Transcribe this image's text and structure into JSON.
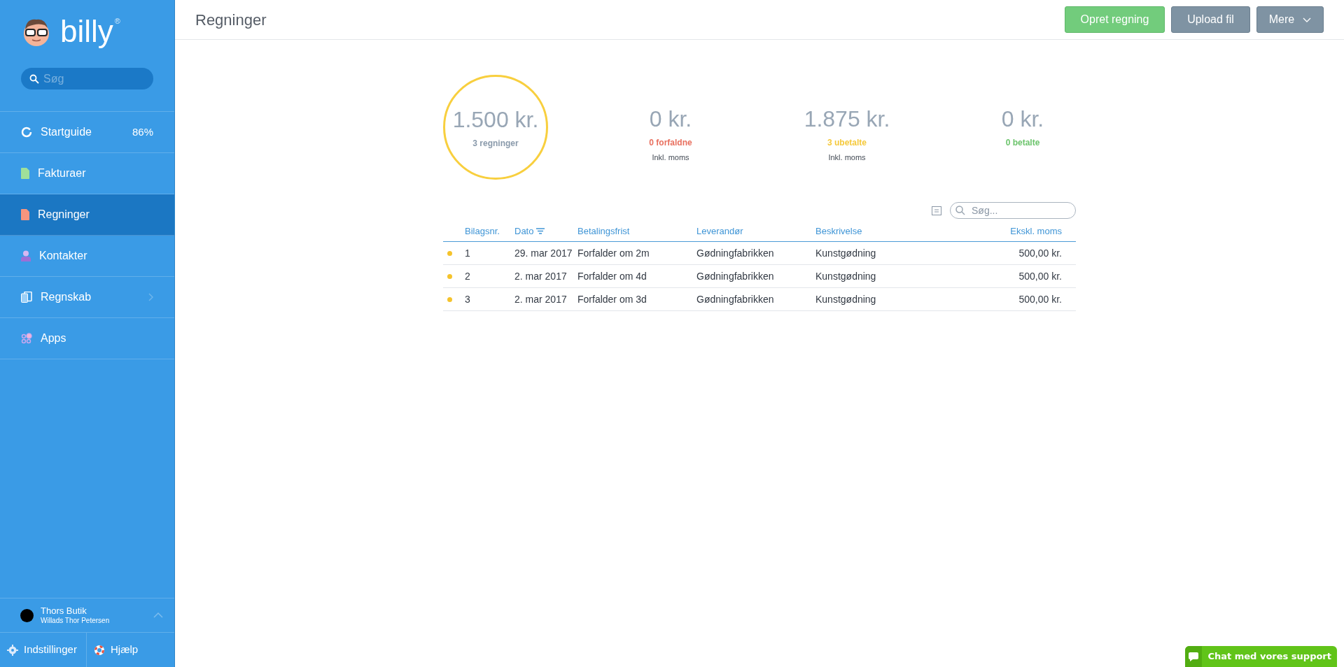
{
  "sidebar": {
    "logo": "billy",
    "logo_mark": "®",
    "search": {
      "placeholder": "Søg"
    },
    "items": [
      {
        "label": "Startguide",
        "badge": "86%",
        "selected": false,
        "submenu": false
      },
      {
        "label": "Fakturaer",
        "selected": false,
        "submenu": false
      },
      {
        "label": "Regninger",
        "selected": true,
        "submenu": false
      },
      {
        "label": "Kontakter",
        "selected": false,
        "submenu": false
      },
      {
        "label": "Regnskab",
        "selected": false,
        "submenu": true
      },
      {
        "label": "Apps",
        "selected": false,
        "submenu": false
      }
    ],
    "account": {
      "company": "Thors Butik",
      "user": "Willads Thor Petersen"
    },
    "footer": [
      "Indstillinger",
      "Hjælp"
    ]
  },
  "header": {
    "title": "Regninger",
    "buttons": [
      {
        "label": "Opret regning",
        "kind": "primary"
      },
      {
        "label": "Upload fil",
        "kind": "secondary"
      },
      {
        "label": "Mere",
        "kind": "dropdown"
      }
    ]
  },
  "stats": [
    {
      "kind": "ring",
      "amount": "1.500 kr.",
      "label": "3 regninger",
      "color": "#8a9aab"
    },
    {
      "kind": "plain",
      "amount": "0 kr.",
      "label": "0 forfaldne",
      "color": "#e8705f",
      "note": "Inkl. moms"
    },
    {
      "kind": "plain",
      "amount": "1.875 kr.",
      "label": "3 ubetalte",
      "color": "#f5c93c",
      "note": "Inkl. moms"
    },
    {
      "kind": "plain",
      "amount": "0 kr.",
      "label": "0 betalte",
      "color": "#6cc46c"
    }
  ],
  "table": {
    "search": {
      "placeholder": "Søg..."
    },
    "columns": [
      {
        "label": "Bilagsnr.",
        "sorted": false
      },
      {
        "label": "Dato",
        "sorted": true
      },
      {
        "label": "Betalingsfrist",
        "sorted": false
      },
      {
        "label": "Leverandør",
        "sorted": false
      },
      {
        "label": "Beskrivelse",
        "sorted": false
      },
      {
        "label": "Ekskl. moms",
        "sorted": false
      }
    ],
    "rows": [
      {
        "color": "#f5c32c",
        "cells": [
          "1",
          "29. mar 2017",
          "Forfalder om 2m",
          "Gødningfabrikken",
          "Kunstgødning",
          "500,00 kr."
        ]
      },
      {
        "color": "#f5c32c",
        "cells": [
          "2",
          "2. mar 2017",
          "Forfalder om 4d",
          "Gødningfabrikken",
          "Kunstgødning",
          "500,00 kr."
        ]
      },
      {
        "color": "#f5c32c",
        "cells": [
          "3",
          "2. mar 2017",
          "Forfalder om 3d",
          "Gødningfabrikken",
          "Kunstgødning",
          "500,00 kr."
        ]
      }
    ]
  },
  "chat": {
    "label": "Chat med vores support"
  }
}
